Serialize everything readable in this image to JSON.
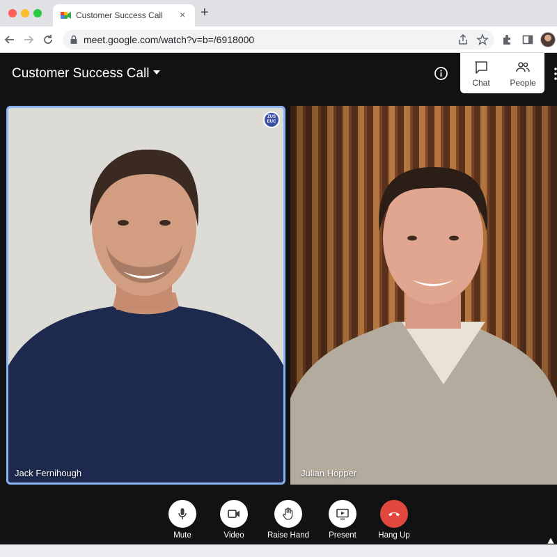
{
  "browser": {
    "tab_title": "Customer Success Call",
    "tab_close": "×",
    "new_tab": "+",
    "url": "meet.google.com/watch?v=b=/6918000"
  },
  "meeting": {
    "title": "Customer Success Call"
  },
  "side_panel": {
    "chat_label": "Chat",
    "people_label": "People"
  },
  "participants": [
    {
      "name": "Jack Fernihough",
      "active_speaker": true,
      "badge": "ZUS EUC"
    },
    {
      "name": "Julian Hopper",
      "active_speaker": false
    }
  ],
  "controls": {
    "mute": "Mute",
    "video": "Video",
    "raise_hand": "Raise Hand",
    "present": "Present",
    "hang_up": "Hang Up"
  },
  "colors": {
    "active_border": "#8ab4f8",
    "hang_up": "#e0483d",
    "meet_bg": "#111214"
  }
}
